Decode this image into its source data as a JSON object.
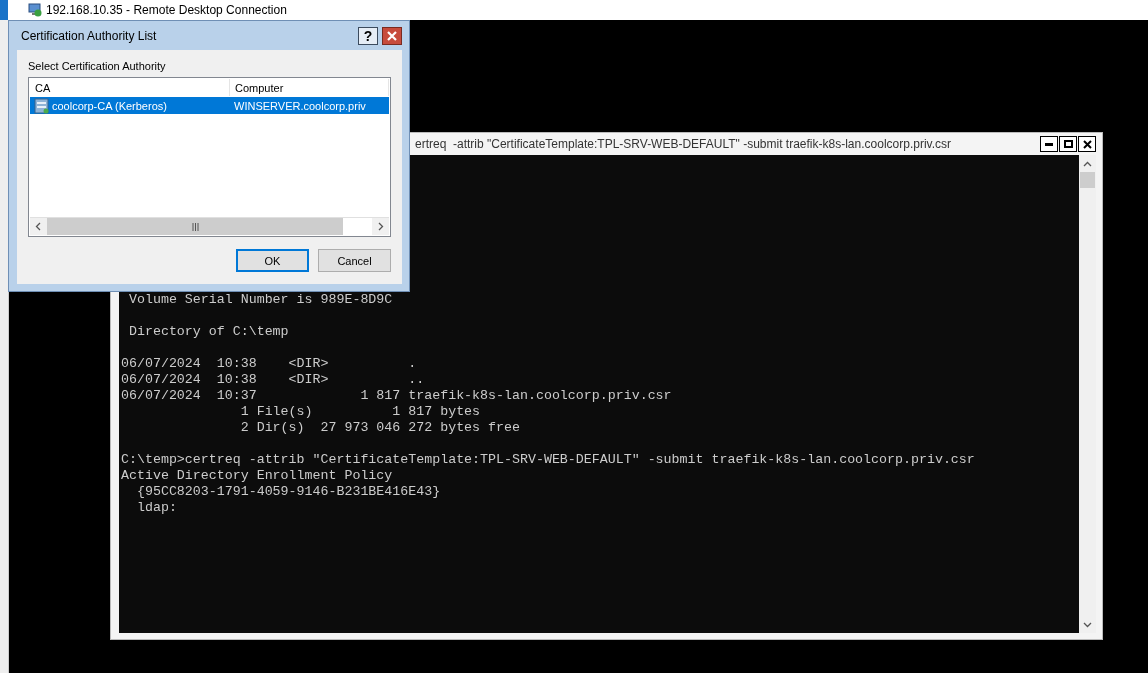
{
  "rdp_window": {
    "title": "192.168.10.35 - Remote Desktop Connection"
  },
  "console_window": {
    "title": "ertreq  -attrib \"CertificateTemplate:TPL-SRV-WEB-DEFAULT\" -submit traefik-k8s-lan.coolcorp.priv.csr",
    "blocks": [
      [
        " Volume Serial Number is 989E-8D9C"
      ],
      [
        " Directory of C:\\temp"
      ],
      [
        "06/07/2024  10:38    <DIR>          .",
        "06/07/2024  10:38    <DIR>          ..",
        "06/07/2024  10:37             1 817 traefik-k8s-lan.coolcorp.priv.csr",
        "               1 File(s)          1 817 bytes",
        "               2 Dir(s)  27 973 046 272 bytes free"
      ],
      [
        "C:\\temp>certreq -attrib \"CertificateTemplate:TPL-SRV-WEB-DEFAULT\" -submit traefik-k8s-lan.coolcorp.priv.csr",
        "Active Directory Enrollment Policy",
        "  {95CC8203-1791-4059-9146-B231BE416E43}",
        "  ldap:"
      ]
    ]
  },
  "dialog": {
    "title": "Certification Authority List",
    "help": "?",
    "prompt": "Select Certification Authority",
    "columns": [
      "CA",
      "Computer"
    ],
    "rows": [
      {
        "ca": "coolcorp-CA (Kerberos)",
        "computer": "WINSERVER.coolcorp.priv",
        "selected": true
      }
    ],
    "buttons": [
      {
        "label": "OK",
        "default": true
      },
      {
        "label": "Cancel",
        "default": false
      }
    ]
  }
}
